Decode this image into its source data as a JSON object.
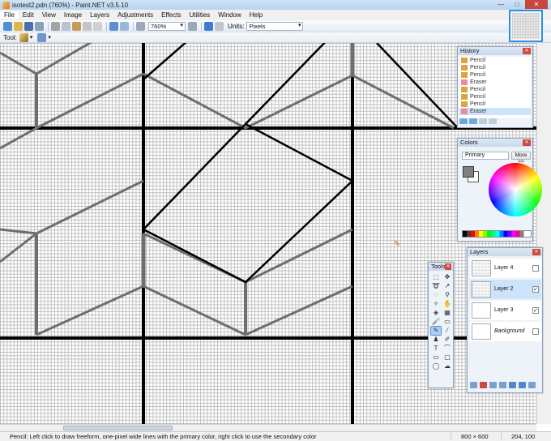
{
  "window": {
    "title": "isotest2.pdn (760%) - Paint.NET v3.5.10"
  },
  "menu": [
    "File",
    "Edit",
    "View",
    "Image",
    "Layers",
    "Adjustments",
    "Effects",
    "Utilities",
    "Window",
    "Help"
  ],
  "toolbar": {
    "zoom_value": "760%",
    "units_label": "Units:",
    "units_value": "Pixels",
    "tool_label": "Tool:"
  },
  "history": {
    "title": "History",
    "items": [
      "Pencil",
      "Pencil",
      "Pencil",
      "Eraser",
      "Pencil",
      "Pencil",
      "Pencil",
      "Eraser"
    ],
    "selected_index": 7
  },
  "colors": {
    "title": "Colors",
    "mode": "Primary",
    "more_label": "More >>",
    "primary_color": "#808080",
    "secondary_color": "#ffffff"
  },
  "layers": {
    "title": "Layers",
    "items": [
      {
        "name": "Layer 4",
        "visible": false
      },
      {
        "name": "Layer 2",
        "visible": true
      },
      {
        "name": "Layer 3",
        "visible": true
      },
      {
        "name": "Background",
        "visible": false
      }
    ],
    "selected_index": 1
  },
  "tools": {
    "title": "Tools"
  },
  "status": {
    "hint": "Pencil: Left click to draw freeform, one-pixel wide lines with the primary color, right click to use the secondary color",
    "image_size": "800 × 600",
    "cursor_pos": "204, 100"
  }
}
